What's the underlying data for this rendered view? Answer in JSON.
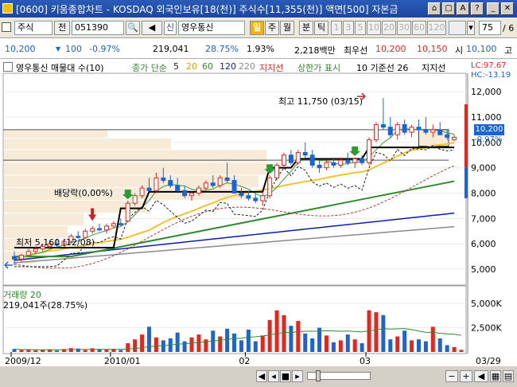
{
  "title": "[0600] 키움종합차트 - KOSDAQ 외국인보유[18(천)] 주식수[11,355(천)] 액면[500] 자본금",
  "toolbar": {
    "market": "주식",
    "prev": "전",
    "code": "051390",
    "market_tag": "신",
    "name": "영우통신",
    "period_selected": "일",
    "period_week": "주",
    "period_month": "월",
    "min": "분",
    "tick": "틱",
    "n1": "1",
    "n3": "3",
    "n5": "5",
    "n10": "10",
    "n20": "20",
    "n30": "30",
    "n60": "60",
    "n120": "120",
    "count": "75",
    "count_suffix": "/ 6"
  },
  "quote": {
    "price": "10,200",
    "change": "100",
    "change_pct": "-0.97%",
    "volume": "219,041",
    "vol_ratio": "28.75%",
    "turnover": "1.93%",
    "amount": "2,218백만",
    "pref_label": "최우선",
    "bid1": "10,200",
    "ask1": "10,150",
    "open_label": "시",
    "open": "10,100",
    "high_label": "고"
  },
  "legend": {
    "item1": "영우통신 매물대 수(10)",
    "ma_label": "종가 단순",
    "ma5": "5",
    "ma20": "20",
    "ma60": "60",
    "ma120": "120",
    "ma220": "220",
    "support": "지지선",
    "limit": "상한가 표시",
    "base": "10 기준선 26",
    "support2": "지지선"
  },
  "annotations": {
    "high": "최고 11,750 (03/15)",
    "low": "최저 5,160 (12/08)",
    "dividend": "배당락(0,00%)"
  },
  "right_panel": {
    "lc": "LC:97.67",
    "hc": "HC:-13.19",
    "price_tag": "10,200",
    "pct_tag": "-0.97%"
  },
  "volume_panel": {
    "title": "거래량 20",
    "value": "219,041주(28.75%)"
  },
  "chart_data": {
    "type": "candlestick",
    "price_axis": [
      "12,000",
      "11,000",
      "10,000",
      "9,000",
      "8,000",
      "7,000",
      "6,000",
      "5,000"
    ],
    "volume_axis": [
      "5,000K",
      "2,500K"
    ],
    "x_labels": [
      "2009/12",
      "2010/01",
      "02",
      "03",
      "03/29"
    ],
    "ylim": [
      4500,
      12600
    ],
    "candles": [
      {
        "o": 5500,
        "h": 5700,
        "l": 5160,
        "c": 5400
      },
      {
        "o": 5400,
        "h": 5600,
        "l": 5300,
        "c": 5550
      },
      {
        "o": 5550,
        "h": 5800,
        "l": 5500,
        "c": 5700
      },
      {
        "o": 5700,
        "h": 5900,
        "l": 5600,
        "c": 5800
      },
      {
        "o": 5800,
        "h": 6000,
        "l": 5700,
        "c": 5900
      },
      {
        "o": 5900,
        "h": 6100,
        "l": 5800,
        "c": 6000
      },
      {
        "o": 6000,
        "h": 6200,
        "l": 5850,
        "c": 5950
      },
      {
        "o": 5950,
        "h": 6200,
        "l": 5900,
        "c": 6100
      },
      {
        "o": 6100,
        "h": 6400,
        "l": 6000,
        "c": 6300
      },
      {
        "o": 6300,
        "h": 6500,
        "l": 6200,
        "c": 6250
      },
      {
        "o": 6250,
        "h": 6600,
        "l": 6200,
        "c": 6500
      },
      {
        "o": 6500,
        "h": 6700,
        "l": 6400,
        "c": 6600
      },
      {
        "o": 6600,
        "h": 6800,
        "l": 6500,
        "c": 6550
      },
      {
        "o": 6550,
        "h": 6800,
        "l": 6400,
        "c": 6700
      },
      {
        "o": 6700,
        "h": 6900,
        "l": 6600,
        "c": 6800
      },
      {
        "o": 6800,
        "h": 7000,
        "l": 6700,
        "c": 6750
      },
      {
        "o": 6900,
        "h": 7700,
        "l": 6850,
        "c": 7600
      },
      {
        "o": 7600,
        "h": 8000,
        "l": 7500,
        "c": 7900
      },
      {
        "o": 7900,
        "h": 8300,
        "l": 7800,
        "c": 8200
      },
      {
        "o": 8200,
        "h": 8600,
        "l": 8100,
        "c": 8100
      },
      {
        "o": 8100,
        "h": 8800,
        "l": 8000,
        "c": 8600
      },
      {
        "o": 8600,
        "h": 9000,
        "l": 8400,
        "c": 8500
      },
      {
        "o": 8500,
        "h": 8700,
        "l": 8200,
        "c": 8300
      },
      {
        "o": 8300,
        "h": 8600,
        "l": 8000,
        "c": 8100
      },
      {
        "o": 8100,
        "h": 8300,
        "l": 7800,
        "c": 7900
      },
      {
        "o": 7900,
        "h": 8100,
        "l": 7700,
        "c": 8000
      },
      {
        "o": 8000,
        "h": 8300,
        "l": 7900,
        "c": 8200
      },
      {
        "o": 8200,
        "h": 8500,
        "l": 8100,
        "c": 8400
      },
      {
        "o": 8400,
        "h": 8700,
        "l": 8200,
        "c": 8300
      },
      {
        "o": 8300,
        "h": 8700,
        "l": 8200,
        "c": 8600
      },
      {
        "o": 8600,
        "h": 9200,
        "l": 8400,
        "c": 8500
      },
      {
        "o": 8500,
        "h": 8700,
        "l": 8200,
        "c": 8000
      },
      {
        "o": 8000,
        "h": 8200,
        "l": 7800,
        "c": 7900
      },
      {
        "o": 7900,
        "h": 8100,
        "l": 7700,
        "c": 7800
      },
      {
        "o": 7800,
        "h": 8000,
        "l": 7600,
        "c": 7700
      },
      {
        "o": 7700,
        "h": 8000,
        "l": 7500,
        "c": 7900
      },
      {
        "o": 7900,
        "h": 8700,
        "l": 7800,
        "c": 8600
      },
      {
        "o": 8600,
        "h": 9200,
        "l": 8500,
        "c": 9100
      },
      {
        "o": 9100,
        "h": 9600,
        "l": 9000,
        "c": 9500
      },
      {
        "o": 9500,
        "h": 9700,
        "l": 9100,
        "c": 9200
      },
      {
        "o": 9200,
        "h": 9700,
        "l": 9100,
        "c": 9600
      },
      {
        "o": 9600,
        "h": 10000,
        "l": 9400,
        "c": 9500
      },
      {
        "o": 9500,
        "h": 9700,
        "l": 9000,
        "c": 9100
      },
      {
        "o": 9100,
        "h": 9300,
        "l": 8800,
        "c": 9000
      },
      {
        "o": 9000,
        "h": 9300,
        "l": 8900,
        "c": 9200
      },
      {
        "o": 9200,
        "h": 9400,
        "l": 9000,
        "c": 9100
      },
      {
        "o": 9100,
        "h": 9400,
        "l": 9000,
        "c": 9300
      },
      {
        "o": 9300,
        "h": 9600,
        "l": 9100,
        "c": 9200
      },
      {
        "o": 9200,
        "h": 9400,
        "l": 9000,
        "c": 9350
      },
      {
        "o": 9350,
        "h": 9500,
        "l": 9100,
        "c": 9200
      },
      {
        "o": 9200,
        "h": 10200,
        "l": 9100,
        "c": 10100
      },
      {
        "o": 10100,
        "h": 10800,
        "l": 10000,
        "c": 10700
      },
      {
        "o": 10700,
        "h": 11750,
        "l": 10500,
        "c": 10600
      },
      {
        "o": 10600,
        "h": 11000,
        "l": 10200,
        "c": 10300
      },
      {
        "o": 10300,
        "h": 10800,
        "l": 10100,
        "c": 10700
      },
      {
        "o": 10700,
        "h": 10900,
        "l": 10300,
        "c": 10400
      },
      {
        "o": 10400,
        "h": 10700,
        "l": 10200,
        "c": 10600
      },
      {
        "o": 10600,
        "h": 10900,
        "l": 10400,
        "c": 10500
      },
      {
        "o": 10500,
        "h": 11000,
        "l": 10300,
        "c": 10400
      },
      {
        "o": 10400,
        "h": 10700,
        "l": 10200,
        "c": 10500
      },
      {
        "o": 10500,
        "h": 10800,
        "l": 10300,
        "c": 10300
      },
      {
        "o": 10300,
        "h": 10500,
        "l": 10100,
        "c": 10200
      },
      {
        "o": 10100,
        "h": 10300,
        "l": 10050,
        "c": 10200
      }
    ],
    "volumes": [
      300,
      200,
      250,
      180,
      220,
      260,
      150,
      300,
      400,
      350,
      200,
      380,
      300,
      250,
      320,
      200,
      900,
      1300,
      1800,
      2600,
      1500,
      1200,
      1400,
      2000,
      1100,
      1500,
      1800,
      1300,
      2200,
      1600,
      2400,
      1900,
      1200,
      2300,
      1100,
      1700,
      3300,
      4300,
      3800,
      2700,
      3200,
      1900,
      1400,
      2500,
      1700,
      1000,
      1200,
      1800,
      1300,
      900,
      4300,
      4100,
      3800,
      1300,
      1600,
      2200,
      1200,
      1300,
      1100,
      2600,
      1400,
      700,
      500,
      219
    ]
  },
  "colors": {
    "up": "#e8251b",
    "down": "#1c63d6",
    "ma5": "#1f1f1f",
    "ma20": "#f2c230",
    "ma60": "#2f8a2f",
    "ma120": "#0a1fa8",
    "ma220": "#8a8a8a"
  }
}
